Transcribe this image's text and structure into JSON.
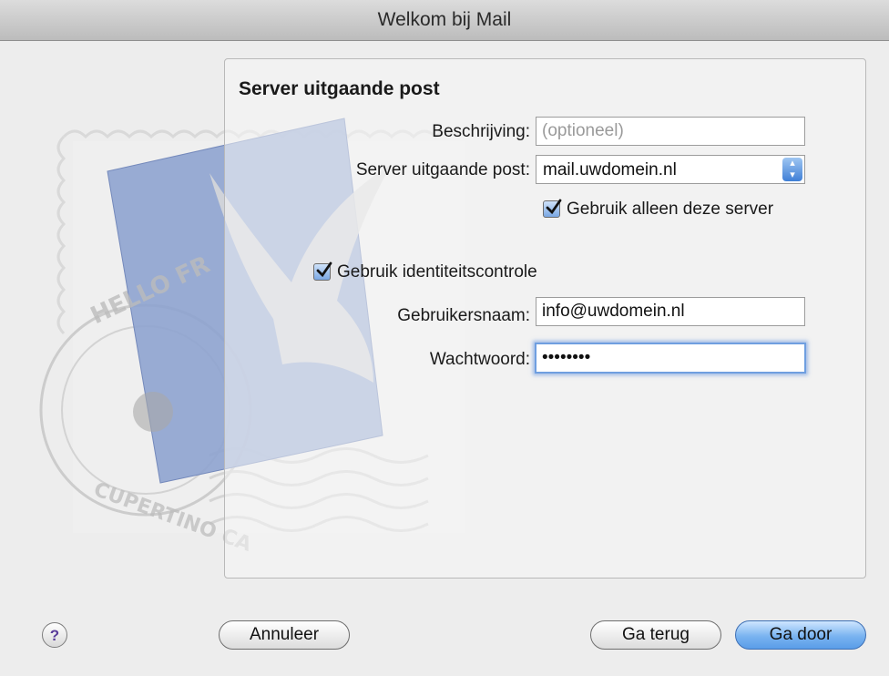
{
  "window": {
    "title": "Welkom bij Mail"
  },
  "stamp": {
    "text_top": "HELLO FR",
    "text_bottom": "CUPERTINO CA"
  },
  "panel": {
    "heading": "Server uitgaande post",
    "description": {
      "label": "Beschrijving:",
      "placeholder": "(optioneel)",
      "value": ""
    },
    "outgoing_server": {
      "label": "Server uitgaande post:",
      "value": "mail.uwdomein.nl"
    },
    "use_only_this_server": {
      "label": "Gebruik alleen deze server",
      "checked": true
    },
    "use_authentication": {
      "label": "Gebruik identiteitscontrole",
      "checked": true
    },
    "username": {
      "label": "Gebruikersnaam:",
      "value": "info@uwdomein.nl"
    },
    "password": {
      "label": "Wachtwoord:",
      "value": "12345678"
    }
  },
  "buttons": {
    "help": "?",
    "cancel": "Annuleer",
    "back": "Ga terug",
    "continue": "Ga door"
  },
  "colors": {
    "accent": "#5a9de8",
    "focus_ring": "#6f9fe0"
  }
}
